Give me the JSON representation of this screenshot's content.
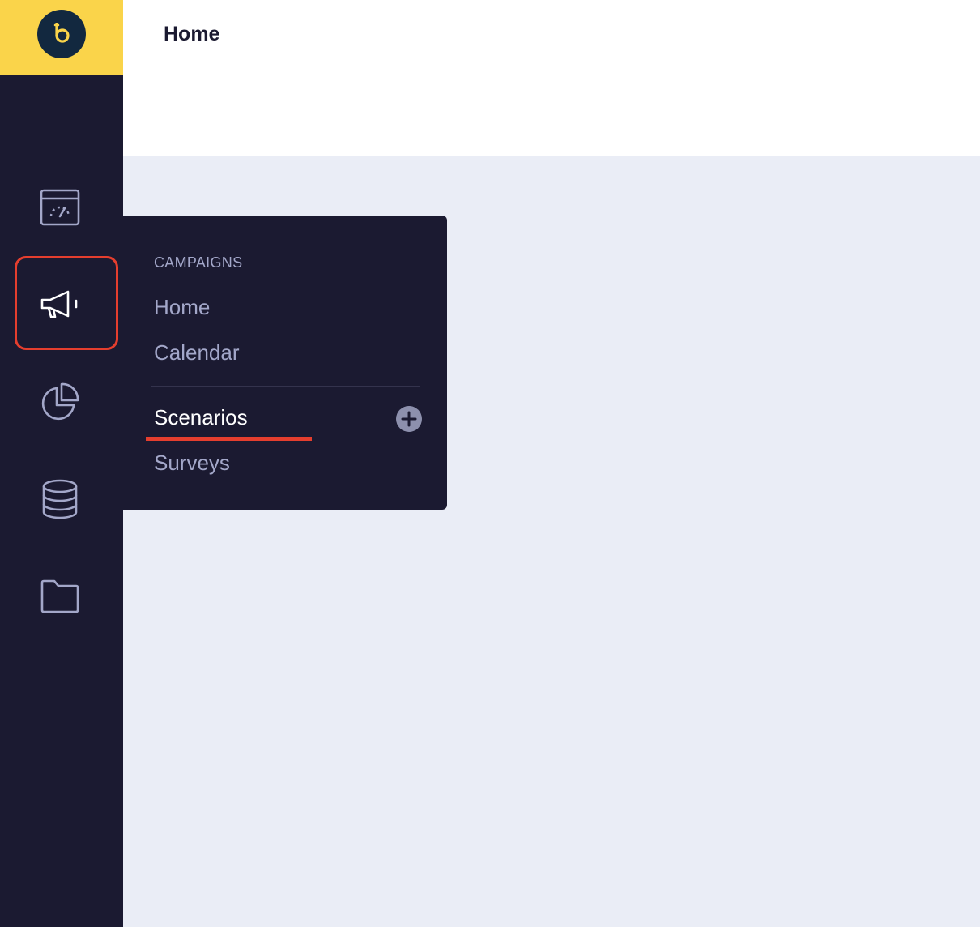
{
  "header": {
    "title": "Home"
  },
  "sidebar": {
    "logo_icon": "brand-logo-icon",
    "items": [
      {
        "icon": "dashboard-icon"
      },
      {
        "icon": "megaphone-icon",
        "active": true
      },
      {
        "icon": "pie-chart-icon"
      },
      {
        "icon": "database-icon"
      },
      {
        "icon": "folder-icon"
      }
    ]
  },
  "flyout": {
    "heading": "CAMPAIGNS",
    "items": [
      {
        "label": "Home"
      },
      {
        "label": "Calendar"
      },
      {
        "label": "Scenarios",
        "active": true
      },
      {
        "label": "Surveys"
      }
    ],
    "add_icon": "plus-circle-icon"
  },
  "colors": {
    "sidebar_bg": "#1b1a31",
    "logo_bg": "#fad44a",
    "accent_red": "#e53e2e",
    "content_bg": "#eaedf6",
    "muted_text": "#a3a7c9"
  }
}
